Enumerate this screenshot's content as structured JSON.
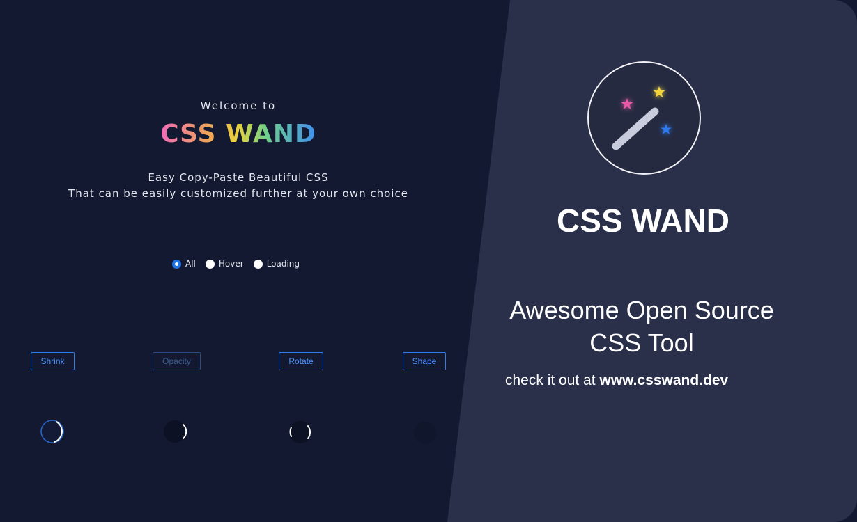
{
  "left": {
    "welcome": "Welcome to",
    "brand": "CSS WAND",
    "tagline_1": "Easy Copy-Paste Beautiful CSS",
    "tagline_2": "That can be easily customized further at your own choice",
    "filters": [
      {
        "label": "All",
        "selected": true
      },
      {
        "label": "Hover",
        "selected": false
      },
      {
        "label": "Loading",
        "selected": false
      }
    ],
    "buttons": [
      {
        "label": "Shrink"
      },
      {
        "label": "Opacity"
      },
      {
        "label": "Rotate"
      },
      {
        "label": "Shape"
      }
    ]
  },
  "right": {
    "logo": "magic-wand-icon",
    "title": "CSS WAND",
    "subtitle_1": "Awesome Open Source",
    "subtitle_2": "CSS Tool",
    "cta_prefix": "check it out at",
    "cta_url": "www.csswand.dev"
  },
  "colors": {
    "left_bg": "#131930",
    "right_bg": "#2a2f4a",
    "accent_blue": "#2f7cf0",
    "star_pink": "#e85aa8",
    "star_yellow": "#f2d43a",
    "star_blue": "#2f7cf0"
  }
}
